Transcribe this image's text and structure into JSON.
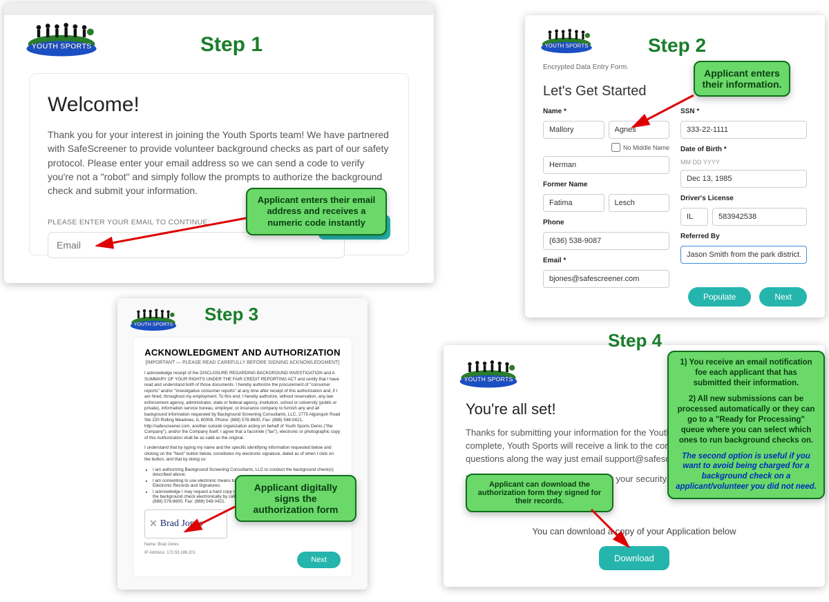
{
  "brand": {
    "logo_text": "YOUTH SPORTS"
  },
  "steps": {
    "s1": "Step 1",
    "s2": "Step 2",
    "s3": "Step 3",
    "s4": "Step 4"
  },
  "callouts": {
    "c1": "Applicant enters their email address and receives a numeric code instantly",
    "c2": "Applicant enters their information.",
    "c3": "Applicant digitally signs the authorization form",
    "c4a": "Applicant can download the authorization form they signed for their records.",
    "c4b_l1": "1) You receive an email notification foe each applicant that has submitted their information.",
    "c4b_l2": "2) All new submissions can be processed automatically or they can go to a \"Ready for Processing\" queue where you can select which ones to run background checks on.",
    "c4b_l3": "The second option is useful if you want to avoid being charged for a background check on a applicant/volunteer you did not need."
  },
  "step1": {
    "heading": "Welcome!",
    "body": "Thank you for your interest in joining the Youth Sports team! We have partnered with SafeScreener to provide volunteer background checks as part of our safety protocol. Please enter your email address so we can send a code to verify you're not a \"robot\" and simply follow the prompts to authorize the background check and submit your information.",
    "email_label": "PLEASE ENTER YOUR EMAIL TO CONTINUE:",
    "email_placeholder": "Email",
    "continue": "Continue"
  },
  "step2": {
    "encrypted_hint": "Encrypted Data Entry Form.",
    "heading": "Let's Get Started",
    "labels": {
      "name": "Name *",
      "middle_cb": "No Middle Name",
      "former": "Former Name",
      "phone": "Phone",
      "email": "Email *",
      "ssn": "SSN *",
      "dob": "Date of Birth *",
      "dob_hint": "MM DD YYYY",
      "dl": "Driver's License",
      "ref": "Referred By"
    },
    "values": {
      "first": "Mallory",
      "middle": "Agnes",
      "last": "Herman",
      "former_first": "Fatima",
      "former_last": "Lesch",
      "phone": "(636) 538-9087",
      "email": "bjones@safescreener.com",
      "ssn": "333-22-1111",
      "dob": "Dec 13, 1985",
      "dl_state": "IL",
      "dl_num": "583942538",
      "referred": "Jason Smith from the park district."
    },
    "buttons": {
      "populate": "Populate",
      "next": "Next"
    }
  },
  "step3": {
    "heading": "ACKNOWLEDGMENT AND AUTHORIZATION",
    "sub": "[IMPORTANT — PLEASE READ CAREFULLY BEFORE SIGNING ACKNOWLEDGMENT]",
    "p1": "I acknowledge receipt of the DISCLOSURE REGARDING BACKGROUND INVESTIGATION and A SUMMARY OF YOUR RIGHTS UNDER THE FAIR CREDIT REPORTING ACT and certify that I have read and understand both of those documents. I hereby authorize the procurement of \"consumer reports\" and/or \"investigative consumer reports\" at any time after receipt of this authorization and, if I am hired, throughout my employment. To this end, I hereby authorize, without reservation, any law enforcement agency, administrator, state or federal agency, institution, school or university (public or private), information service bureau, employer, or insurance company to furnish any and all background information requested by Background Screening Consultants, LLC, 2775 Algonquin Road Ste 220 Rolling Meadows, IL 60008, Phone: (888) 578-8600, Fax: (888) 548-0421, http://safescreener.com, another outside organization acting on behalf of Youth Sports Demo (\"the Company\"), and/or the Company itself. I agree that a facsimile (\"fax\"), electronic or photographic copy of this Authorization shall be as valid as the original.",
    "p2": "I understand that by typing my name and the specific identifying information requested below and clicking on the \"Next\" button below, constitutes my electronic signature, dated as of when I click on the button, and that by doing so:",
    "bullets": [
      "I am authorizing Background Screening Consultants, LLC to conduct the background check(s) described above;",
      "I am consenting to use electronic means to sign this form and have read the Consent to Use Electronic Records and Signatures;",
      "I acknowledge I may request a hard copy of this Authorization after agreeing to be authorized for the background check electronically by calling Background Screening Consultants at Phone: (888) 578-8600, Fax: (888) 548-0421."
    ],
    "signature": "Brad Jones",
    "meta_name": "Name: Brad Jones",
    "meta_ip": "IP Address: 172.59.186.201",
    "next": "Next"
  },
  "step4": {
    "heading": "You're all set!",
    "body": "Thanks for submitting your information for the Youth Sports background check. Once complete, Youth Sports will receive a link to the completed report. If you have questions along the way just email support@safescreener.com. We're here to help!",
    "body2": "This form will not retain your data, for your security. Please close this page when you are finished.",
    "dl_text": "You can download a copy of your Application below",
    "download": "Download"
  }
}
